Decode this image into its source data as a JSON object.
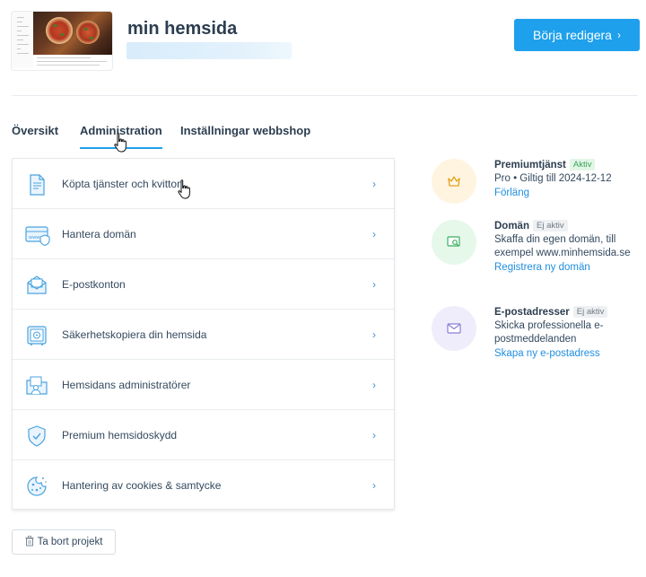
{
  "header": {
    "site_title": "min hemsida",
    "edit_button_label": "Börja redigera",
    "edit_button_chevron": "›"
  },
  "tabs": [
    {
      "label": "Översikt",
      "active": false
    },
    {
      "label": "Administration",
      "active": true
    },
    {
      "label": "Inställningar webbshop",
      "active": false
    }
  ],
  "admin_items": [
    {
      "label": "Köpta tjänster och kvitton",
      "icon": "receipt-icon"
    },
    {
      "label": "Hantera domän",
      "icon": "domain-icon"
    },
    {
      "label": "E-postkonton",
      "icon": "mail-icon"
    },
    {
      "label": "Säkerhetskopiera din hemsida",
      "icon": "safe-icon"
    },
    {
      "label": "Hemsidans administratörer",
      "icon": "admin-folder-icon"
    },
    {
      "label": "Premium hemsidoskydd",
      "icon": "shield-icon"
    },
    {
      "label": "Hantering av cookies & samtycke",
      "icon": "cookie-icon"
    }
  ],
  "item_chevron": "›",
  "side": {
    "premium": {
      "title": "Premiumtjänst",
      "badge": "Aktiv",
      "detail": "Pro • Giltig till 2024-12-12",
      "link": "Förläng",
      "icon": "crown-icon"
    },
    "domain": {
      "title": "Domän",
      "badge": "Ej aktiv",
      "detail": "Skaffa din egen domän, till exempel www.minhemsida.se",
      "link": "Registrera ny domän",
      "icon": "domain-search-icon"
    },
    "email": {
      "title": "E-postadresser",
      "badge": "Ej aktiv",
      "detail": "Skicka professionella e-postmeddelanden",
      "link": "Skapa ny e-postadress",
      "icon": "envelope-icon"
    }
  },
  "delete_button_label": "Ta bort projekt",
  "colors": {
    "accent": "#1ea0ec",
    "link": "#1f8ee0",
    "badge_active": "#3aa35a",
    "premium_bg": "#fff4e0",
    "domain_bg": "#e6f8ea",
    "email_bg": "#efedfb"
  }
}
